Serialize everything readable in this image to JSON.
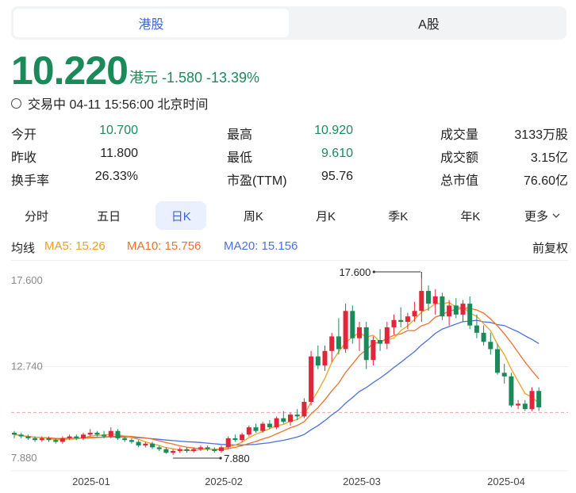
{
  "market_tabs": [
    {
      "label": "港股",
      "active": true
    },
    {
      "label": "A股",
      "active": false
    }
  ],
  "quote": {
    "price": "10.220",
    "currency": "港元",
    "change": "-1.580",
    "change_pct": "-13.39%",
    "status": "交易中 04-11 15:56:00 北京时间"
  },
  "stats": [
    [
      {
        "label": "今开",
        "value": "10.700",
        "tone": "green"
      },
      {
        "label": "最高",
        "value": "10.920",
        "tone": "green"
      },
      {
        "label": "成交量",
        "value": "3133万股",
        "tone": "dark"
      }
    ],
    [
      {
        "label": "昨收",
        "value": "11.800",
        "tone": "dark"
      },
      {
        "label": "最低",
        "value": "9.610",
        "tone": "green"
      },
      {
        "label": "成交额",
        "value": "3.15亿",
        "tone": "dark"
      }
    ],
    [
      {
        "label": "换手率",
        "value": "26.33%",
        "tone": "dark"
      },
      {
        "label": "市盈(TTM)",
        "value": "95.76",
        "tone": "dark"
      },
      {
        "label": "总市值",
        "value": "76.60亿",
        "tone": "dark"
      }
    ]
  ],
  "period_tabs": [
    {
      "label": "分时",
      "active": false
    },
    {
      "label": "五日",
      "active": false
    },
    {
      "label": "日K",
      "active": true
    },
    {
      "label": "周K",
      "active": false
    },
    {
      "label": "月K",
      "active": false
    },
    {
      "label": "季K",
      "active": false
    },
    {
      "label": "年K",
      "active": false
    },
    {
      "label": "更多",
      "active": false
    }
  ],
  "ma_legend": {
    "label": "均线",
    "ma5": "MA5: 15.26",
    "ma10": "MA10: 15.756",
    "ma20": "MA20: 15.156",
    "adjust": "前复权"
  },
  "colors": {
    "up": "#e0263b",
    "down": "#1b8a5a",
    "ma5": "#f0a020",
    "ma10": "#f07030",
    "ma20": "#4a6fe0",
    "accent": "#3b63d8"
  },
  "chart_data": {
    "type": "candlestick",
    "y_ticks": [
      "17.600",
      "12.740",
      "7.880"
    ],
    "ylim": [
      7.88,
      17.6
    ],
    "x_ticks": [
      "2025-01",
      "2025-02",
      "2025-03",
      "2025-04"
    ],
    "high_label": "17.600",
    "low_label": "7.880",
    "last_close": 10.22,
    "candles": [
      [
        9.1,
        9.2,
        8.8,
        9.0
      ],
      [
        9.0,
        9.1,
        8.8,
        8.9
      ],
      [
        8.9,
        9.0,
        8.7,
        8.8
      ],
      [
        8.8,
        8.9,
        8.6,
        8.7
      ],
      [
        8.7,
        8.9,
        8.6,
        8.8
      ],
      [
        8.8,
        8.9,
        8.6,
        8.7
      ],
      [
        8.7,
        8.8,
        8.5,
        8.6
      ],
      [
        8.6,
        8.9,
        8.5,
        8.8
      ],
      [
        8.8,
        9.0,
        8.7,
        8.9
      ],
      [
        8.9,
        9.0,
        8.7,
        8.8
      ],
      [
        8.8,
        9.1,
        8.7,
        9.0
      ],
      [
        9.0,
        9.3,
        8.9,
        9.1
      ],
      [
        9.1,
        9.2,
        8.9,
        9.0
      ],
      [
        9.0,
        9.2,
        8.8,
        8.9
      ],
      [
        8.9,
        9.4,
        8.8,
        9.2
      ],
      [
        9.2,
        9.3,
        8.7,
        8.8
      ],
      [
        8.8,
        8.9,
        8.6,
        8.7
      ],
      [
        8.7,
        8.8,
        8.5,
        8.6
      ],
      [
        8.6,
        8.7,
        8.3,
        8.4
      ],
      [
        8.4,
        8.6,
        8.3,
        8.5
      ],
      [
        8.5,
        8.6,
        8.2,
        8.3
      ],
      [
        8.3,
        8.4,
        8.1,
        8.2
      ],
      [
        8.2,
        8.3,
        7.95,
        8.0
      ],
      [
        8.0,
        8.2,
        7.88,
        8.1
      ],
      [
        8.1,
        8.3,
        8.0,
        8.2
      ],
      [
        8.2,
        8.3,
        8.0,
        8.1
      ],
      [
        8.1,
        8.3,
        8.0,
        8.2
      ],
      [
        8.2,
        8.4,
        8.1,
        8.3
      ],
      [
        8.3,
        8.4,
        8.1,
        8.2
      ],
      [
        8.2,
        8.3,
        8.0,
        8.1
      ],
      [
        8.1,
        8.4,
        8.0,
        8.3
      ],
      [
        8.3,
        8.9,
        8.2,
        8.8
      ],
      [
        8.8,
        9.0,
        8.6,
        8.7
      ],
      [
        8.7,
        9.1,
        8.6,
        9.0
      ],
      [
        9.0,
        9.5,
        8.9,
        9.4
      ],
      [
        9.4,
        9.6,
        9.1,
        9.2
      ],
      [
        9.2,
        9.7,
        9.1,
        9.6
      ],
      [
        9.6,
        9.8,
        9.3,
        9.4
      ],
      [
        9.4,
        10.0,
        9.3,
        9.9
      ],
      [
        9.9,
        10.3,
        9.6,
        9.7
      ],
      [
        9.7,
        10.2,
        9.5,
        10.1
      ],
      [
        10.1,
        10.4,
        9.8,
        10.0
      ],
      [
        10.0,
        11.0,
        9.9,
        10.8
      ],
      [
        10.8,
        13.6,
        10.6,
        13.3
      ],
      [
        13.3,
        13.9,
        12.6,
        12.8
      ],
      [
        12.8,
        13.9,
        12.5,
        13.6
      ],
      [
        13.6,
        14.6,
        13.0,
        14.4
      ],
      [
        14.4,
        15.4,
        13.4,
        13.7
      ],
      [
        13.7,
        16.2,
        13.5,
        15.8
      ],
      [
        15.8,
        16.1,
        14.0,
        14.3
      ],
      [
        14.3,
        15.2,
        13.6,
        14.9
      ],
      [
        14.9,
        15.2,
        12.6,
        13.1
      ],
      [
        13.1,
        14.4,
        12.8,
        14.2
      ],
      [
        14.2,
        14.8,
        13.6,
        14.0
      ],
      [
        14.0,
        15.2,
        13.7,
        14.9
      ],
      [
        14.9,
        15.6,
        14.5,
        15.3
      ],
      [
        15.3,
        16.0,
        14.9,
        15.2
      ],
      [
        15.2,
        15.7,
        14.8,
        15.5
      ],
      [
        15.5,
        16.3,
        15.2,
        15.8
      ],
      [
        15.8,
        17.6,
        15.2,
        16.9
      ],
      [
        16.9,
        17.2,
        15.8,
        16.2
      ],
      [
        16.2,
        17.0,
        15.6,
        16.6
      ],
      [
        16.6,
        16.8,
        15.3,
        15.5
      ],
      [
        15.5,
        16.4,
        15.0,
        16.1
      ],
      [
        16.1,
        16.5,
        15.4,
        15.6
      ],
      [
        15.6,
        16.4,
        15.2,
        16.2
      ],
      [
        16.2,
        16.6,
        14.8,
        15.0
      ],
      [
        15.0,
        15.6,
        14.3,
        14.6
      ],
      [
        14.6,
        15.0,
        13.9,
        14.1
      ],
      [
        14.1,
        14.6,
        13.4,
        13.7
      ],
      [
        13.7,
        14.0,
        12.3,
        12.4
      ],
      [
        12.4,
        12.9,
        11.8,
        12.2
      ],
      [
        12.2,
        12.4,
        10.5,
        10.6
      ],
      [
        10.6,
        10.9,
        10.4,
        10.7
      ],
      [
        10.7,
        10.9,
        10.3,
        10.4
      ],
      [
        10.4,
        11.6,
        10.3,
        11.4
      ],
      [
        11.4,
        11.6,
        10.3,
        10.5
      ]
    ]
  }
}
